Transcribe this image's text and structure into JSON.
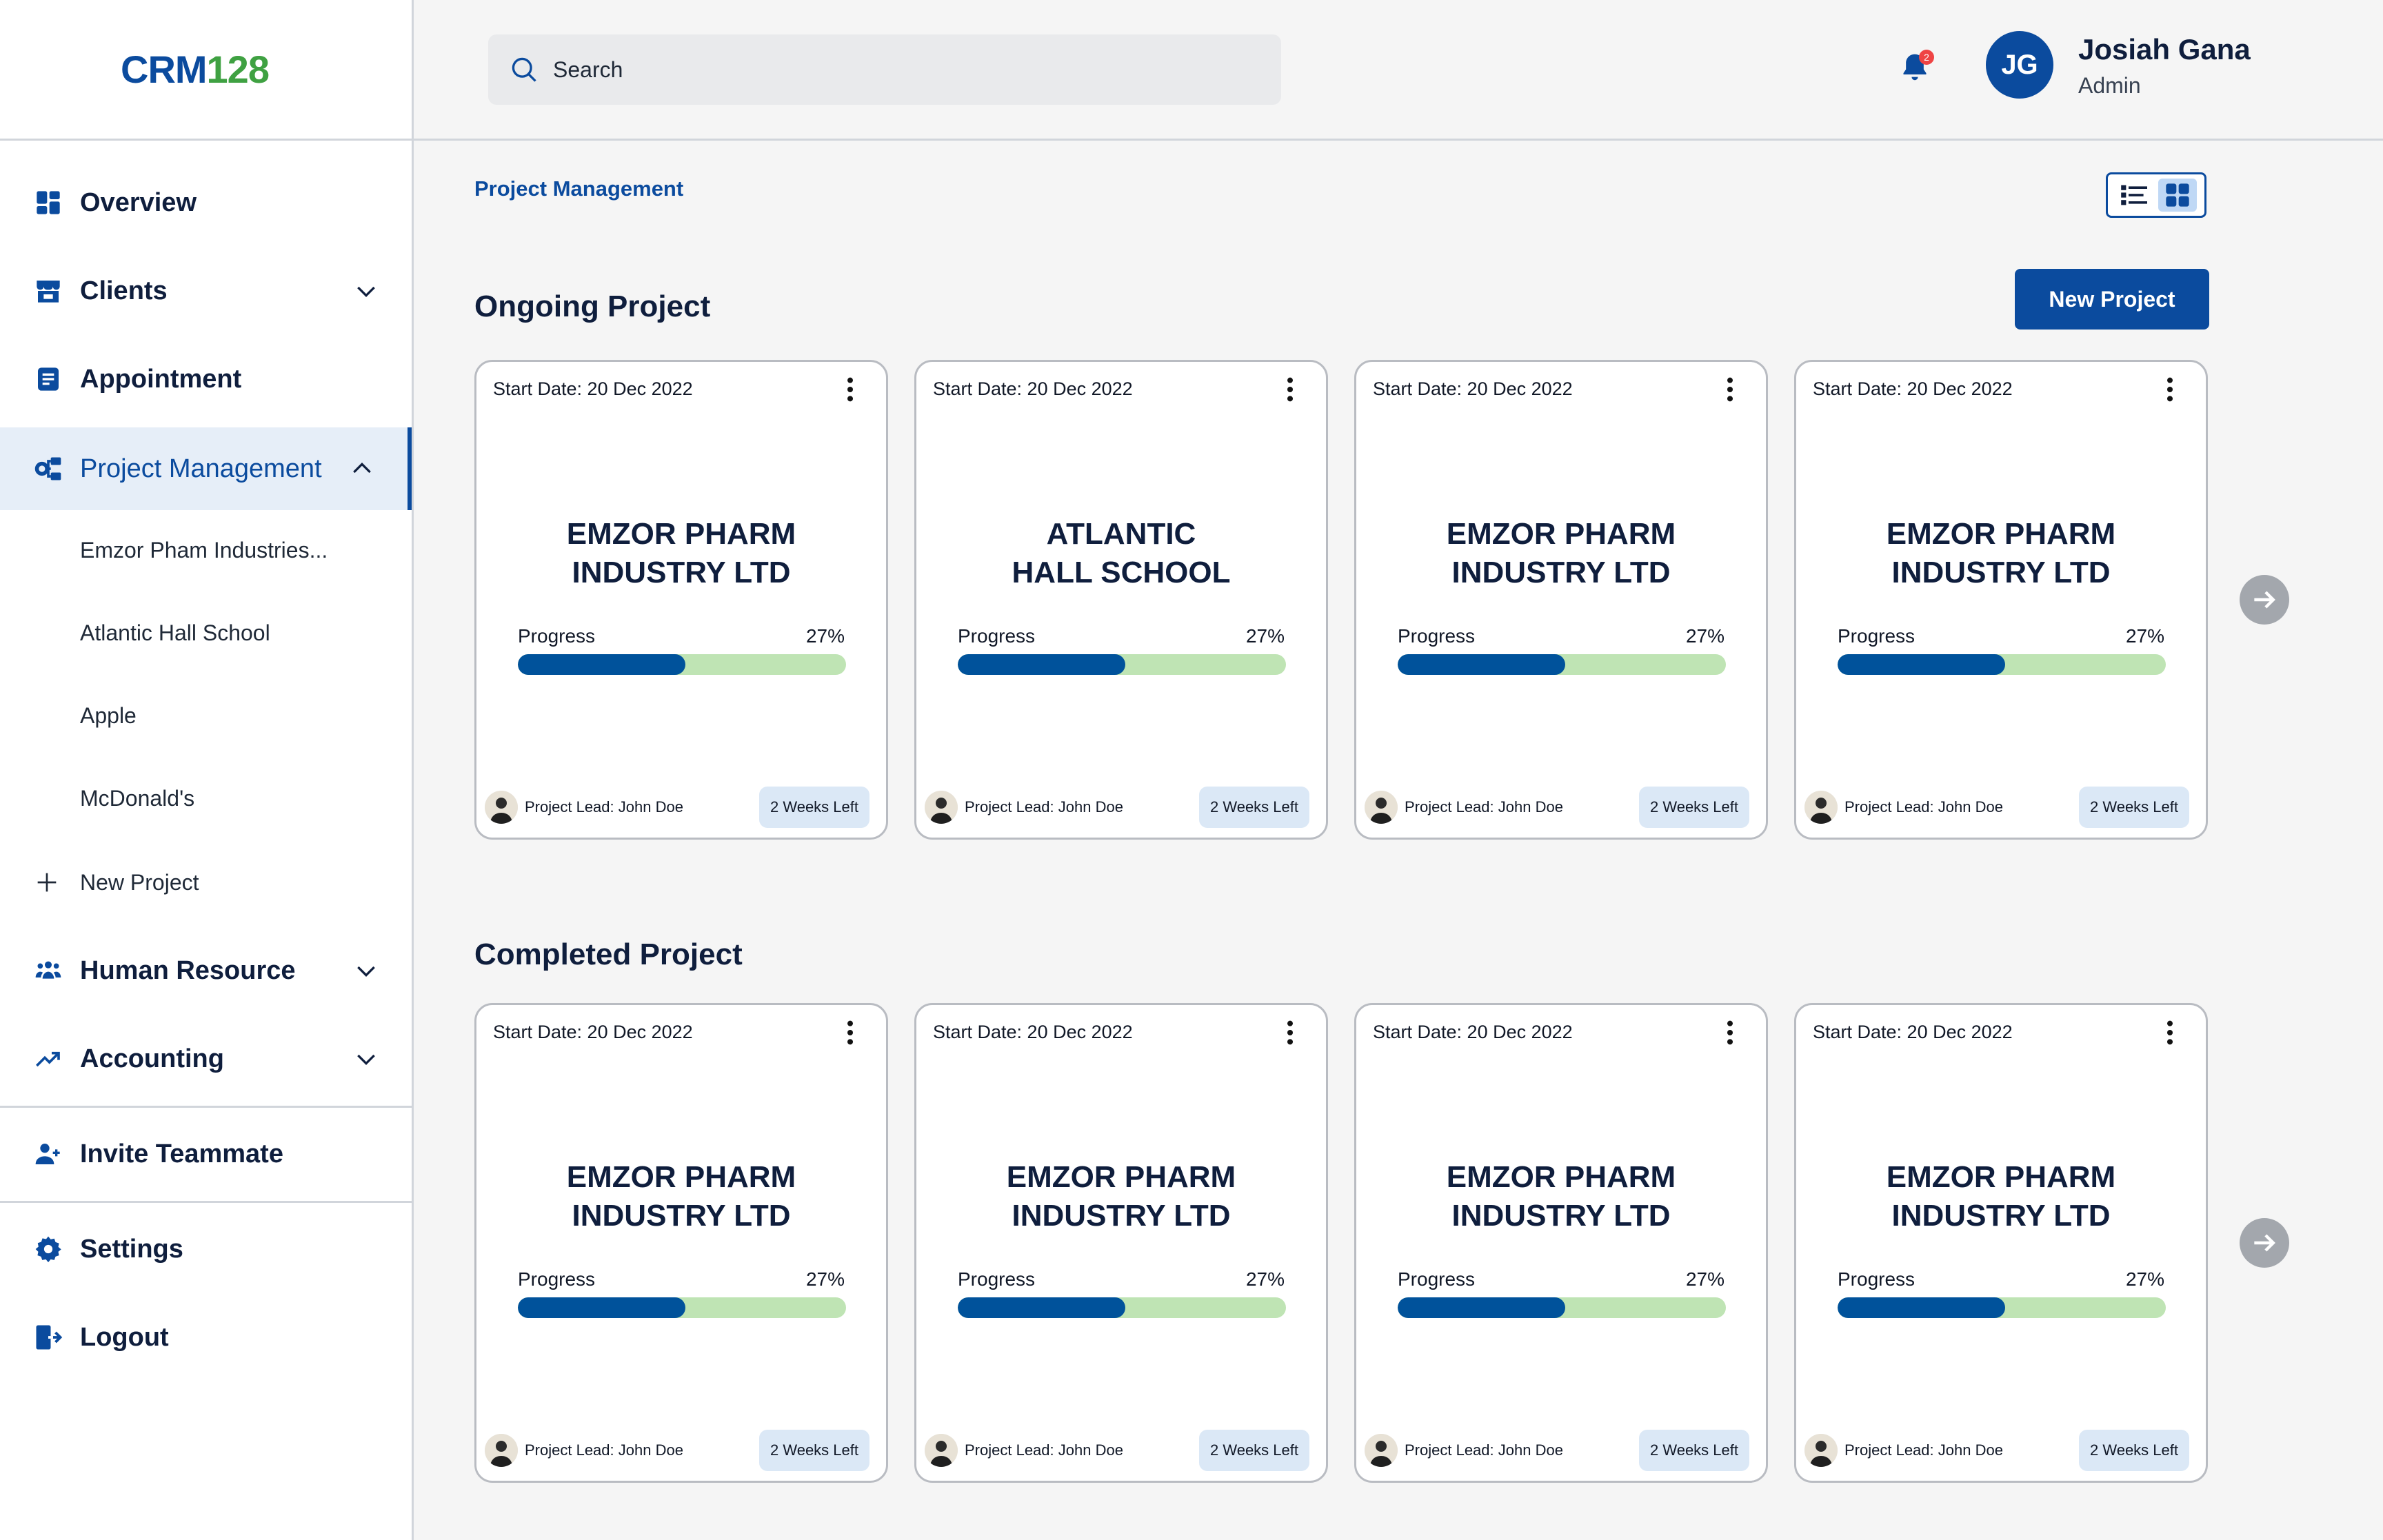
{
  "logo": {
    "part1": "CRM",
    "part2": "128"
  },
  "search": {
    "placeholder": "Search"
  },
  "notifications": {
    "count": "2"
  },
  "user": {
    "initials": "JG",
    "name": "Josiah Gana",
    "role": "Admin"
  },
  "sidebar": {
    "overview": "Overview",
    "clients": "Clients",
    "appointment": "Appointment",
    "project_management": "Project Management",
    "sub_items": [
      "Emzor Pham Industries...",
      "Atlantic Hall School",
      "Apple",
      "McDonald's"
    ],
    "new_project": "New Project",
    "human_resource": "Human Resource",
    "accounting": "Accounting",
    "invite": "Invite Teammate",
    "settings": "Settings",
    "logout": "Logout"
  },
  "breadcrumb": "Project Management",
  "new_project_button": "New Project",
  "ongoing": {
    "title": "Ongoing Project",
    "cards": [
      {
        "start": "Start Date: 20 Dec 2022",
        "name1": "EMZOR PHARM",
        "name2": "INDUSTRY LTD",
        "progress_label": "Progress",
        "progress": "27%",
        "lead": "Project Lead: John Doe",
        "time_left": "2 Weeks Left"
      },
      {
        "start": "Start Date: 20 Dec 2022",
        "name1": "ATLANTIC",
        "name2": "HALL SCHOOL",
        "progress_label": "Progress",
        "progress": "27%",
        "lead": "Project Lead: John Doe",
        "time_left": "2 Weeks Left"
      },
      {
        "start": "Start Date: 20 Dec 2022",
        "name1": "EMZOR PHARM",
        "name2": "INDUSTRY LTD",
        "progress_label": "Progress",
        "progress": "27%",
        "lead": "Project Lead: John Doe",
        "time_left": "2 Weeks Left"
      },
      {
        "start": "Start Date: 20 Dec 2022",
        "name1": "EMZOR PHARM",
        "name2": "INDUSTRY LTD",
        "progress_label": "Progress",
        "progress": "27%",
        "lead": "Project Lead: John Doe",
        "time_left": "2 Weeks Left"
      }
    ]
  },
  "completed": {
    "title": "Completed Project",
    "cards": [
      {
        "start": "Start Date: 20 Dec 2022",
        "name1": "EMZOR PHARM",
        "name2": "INDUSTRY LTD",
        "progress_label": "Progress",
        "progress": "27%",
        "lead": "Project Lead: John Doe",
        "time_left": "2 Weeks Left"
      },
      {
        "start": "Start Date: 20 Dec 2022",
        "name1": "EMZOR PHARM",
        "name2": "INDUSTRY LTD",
        "progress_label": "Progress",
        "progress": "27%",
        "lead": "Project Lead: John Doe",
        "time_left": "2 Weeks Left"
      },
      {
        "start": "Start Date: 20 Dec 2022",
        "name1": "EMZOR PHARM",
        "name2": "INDUSTRY LTD",
        "progress_label": "Progress",
        "progress": "27%",
        "lead": "Project Lead: John Doe",
        "time_left": "2 Weeks Left"
      },
      {
        "start": "Start Date: 20 Dec 2022",
        "name1": "EMZOR PHARM",
        "name2": "INDUSTRY LTD",
        "progress_label": "Progress",
        "progress": "27%",
        "lead": "Project Lead: John Doe",
        "time_left": "2 Weeks Left"
      }
    ]
  },
  "colors": {
    "brand_blue": "#0b4b9e",
    "brand_green": "#3fa142",
    "progress_fill": "#00529b",
    "progress_track": "#bfe4b4"
  }
}
